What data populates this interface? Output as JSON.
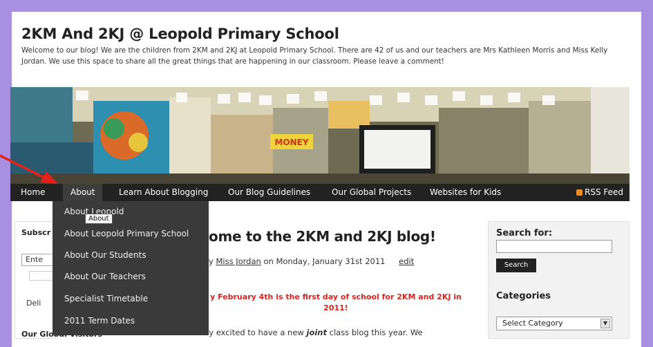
{
  "header": {
    "site_title": "2KM And 2KJ @ Leopold Primary School",
    "description": "Welcome to our blog! We are the children from 2KM and 2KJ at Leopold Primary School. There are 42 of us and our teachers are Mrs Kathleen Morris and Miss Kelly Jordan. We use this space to share all the great things that are happening in our classroom. Please leave a comment!"
  },
  "banner": {
    "sign_text": "MONEY"
  },
  "nav": {
    "items": [
      {
        "label": "Home"
      },
      {
        "label": "About"
      },
      {
        "label": "Learn About Blogging"
      },
      {
        "label": "Our Blog Guidelines"
      },
      {
        "label": "Our Global Projects"
      },
      {
        "label": "Websites for Kids"
      }
    ],
    "rss_label": "RSS Feed"
  },
  "dropdown": {
    "items": [
      {
        "label": "About Leopold"
      },
      {
        "label": "About Leopold Primary School"
      },
      {
        "label": "About Our Students"
      },
      {
        "label": "About Our Teachers"
      },
      {
        "label": "Specialist Timetable"
      },
      {
        "label": "2011 Term Dates"
      }
    ],
    "tooltip": "About"
  },
  "left_widget": {
    "title": "Subscr",
    "input_value": "Ente",
    "deliver_text": "Deli",
    "title2": "Our Global Visitors"
  },
  "post": {
    "title": "ome to the 2KM and 2KJ blog!",
    "meta_prefix": "y ",
    "author": "Miss Jordan",
    "meta_date": " on Monday, January 31st 2011",
    "edit_label": "edit",
    "highlight_line1": "y February 4th is the first day of school for 2KM and 2KJ in",
    "highlight_line2": "2011!",
    "body_prefix": "We are very excited to have a new ",
    "body_emph": "joint",
    "body_suffix": " class blog this year. We"
  },
  "sidebar": {
    "search_title": "Search for:",
    "search_button": "Search",
    "categories_title": "Categories",
    "categories_select": "Select Category"
  },
  "colors": {
    "frame": "#a98fe0",
    "nav_bg": "#222222",
    "accent_red": "#d8251c",
    "arrow_red": "#e2231a"
  }
}
